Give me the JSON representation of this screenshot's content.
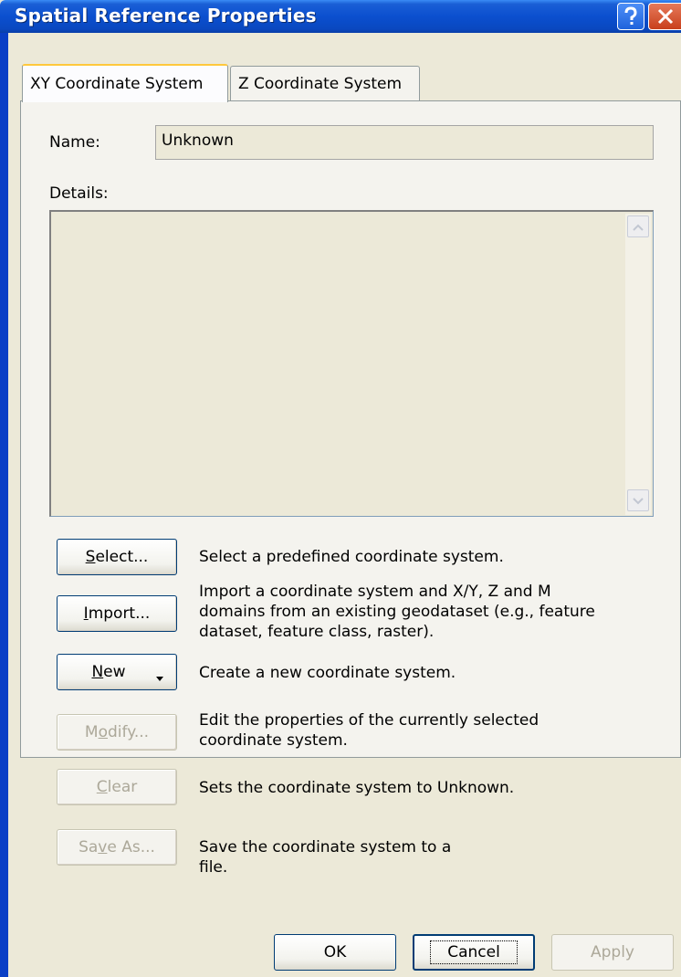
{
  "window": {
    "title": "Spatial Reference Properties"
  },
  "tabs": [
    {
      "label": "XY Coordinate System",
      "active": true
    },
    {
      "label": "Z Coordinate System",
      "active": false
    }
  ],
  "name": {
    "label": "Name:",
    "value": "Unknown"
  },
  "details": {
    "label": "Details:"
  },
  "actions": [
    {
      "pre": "",
      "mnemonic": "S",
      "post": "elect...",
      "enabled": true,
      "description": "Select a predefined coordinate system."
    },
    {
      "pre": "",
      "mnemonic": "I",
      "post": "mport...",
      "enabled": true,
      "description": "Import a coordinate system and X/Y, Z and M domains from an existing geodataset (e.g., feature dataset, feature class, raster)."
    },
    {
      "pre": "",
      "mnemonic": "N",
      "post": "ew",
      "enabled": true,
      "description": "Create a new coordinate system."
    },
    {
      "pre": "M",
      "mnemonic": "o",
      "post": "dify...",
      "enabled": false,
      "description": "Edit the properties of the currently selected coordinate system."
    },
    {
      "pre": "",
      "mnemonic": "C",
      "post": "lear",
      "enabled": false,
      "description": "Sets the coordinate system to Unknown."
    },
    {
      "pre": "Sa",
      "mnemonic": "v",
      "post": "e As...",
      "enabled": false,
      "description": "Save the coordinate system to a file."
    }
  ],
  "footer": {
    "ok": "OK",
    "cancel": "Cancel",
    "apply_pre": "",
    "apply_mnemonic": "A",
    "apply_post": "pply"
  },
  "colors": {
    "titlebar": "#0b4fcf",
    "dialog_bg": "#ece9d8",
    "disabled_text": "#aca899"
  }
}
